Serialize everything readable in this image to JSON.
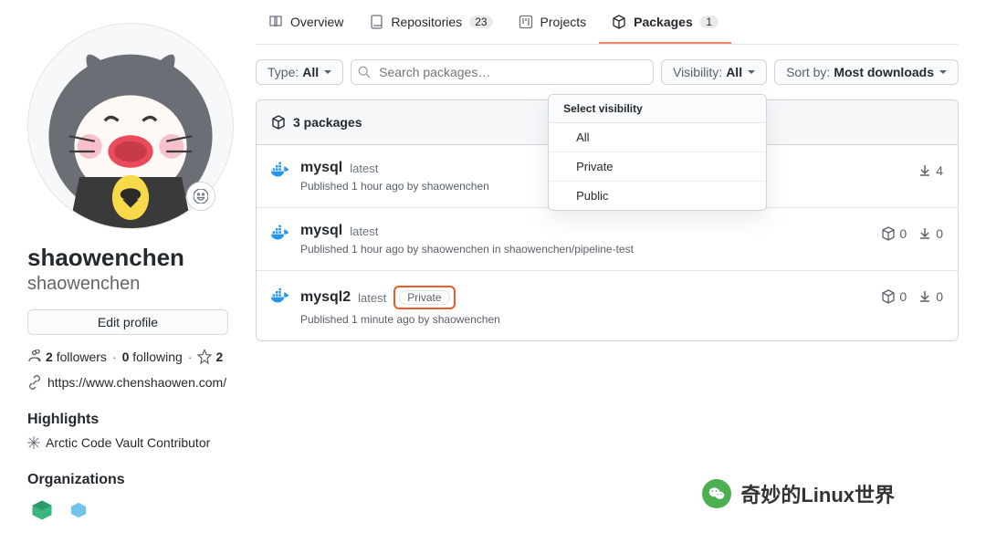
{
  "sidebar": {
    "name": "shaowenchen",
    "login": "shaowenchen",
    "edit_profile": "Edit profile",
    "followers_count": "2",
    "followers_label": "followers",
    "following_count": "0",
    "following_label": "following",
    "stars_count": "2",
    "website": "https://www.chenshaowen.com/",
    "highlights_header": "Highlights",
    "highlight_item": "Arctic Code Vault Contributor",
    "orgs_header": "Organizations"
  },
  "tabs": {
    "overview": "Overview",
    "repositories": "Repositories",
    "repositories_count": "23",
    "projects": "Projects",
    "packages": "Packages",
    "packages_count": "1"
  },
  "filters": {
    "type_label": "Type: ",
    "type_value": "All",
    "search_placeholder": "Search packages…",
    "visibility_label": "Visibility: ",
    "visibility_value": "All",
    "sort_label": "Sort by: ",
    "sort_value": "Most downloads"
  },
  "dropdown": {
    "header": "Select visibility",
    "items": [
      "All",
      "Private",
      "Public"
    ]
  },
  "packages": {
    "count_label": "3 packages",
    "items": [
      {
        "name": "mysql",
        "tag": "latest",
        "private": false,
        "meta": "Published 1 hour ago by shaowenchen",
        "show_deps": false,
        "deps": "",
        "downloads": "4"
      },
      {
        "name": "mysql",
        "tag": "latest",
        "private": false,
        "meta": "Published 1 hour ago by shaowenchen in shaowenchen/pipeline-test",
        "show_deps": true,
        "deps": "0",
        "downloads": "0"
      },
      {
        "name": "mysql2",
        "tag": "latest",
        "private": true,
        "private_label": "Private",
        "meta": "Published 1 minute ago by shaowenchen",
        "show_deps": true,
        "deps": "0",
        "downloads": "0"
      }
    ]
  },
  "watermark": "奇妙的Linux世界"
}
